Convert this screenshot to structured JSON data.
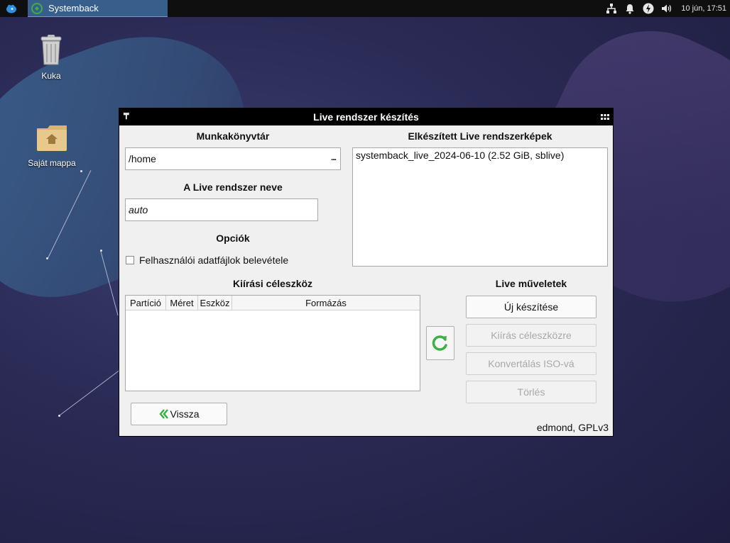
{
  "taskbar": {
    "task_label": "Systemback",
    "clock": "10 jún, 17:51"
  },
  "desktop": {
    "icons": [
      {
        "label": "Kuka",
        "icon": "trash-icon"
      },
      {
        "label": "Saját mappa",
        "icon": "home-folder-icon"
      }
    ]
  },
  "window": {
    "title": "Live rendszer készítés",
    "workdir": {
      "title": "Munkakönyvtár",
      "value": "/home",
      "browse_label": "..."
    },
    "live_name": {
      "title": "A Live rendszer neve",
      "value": "auto"
    },
    "options": {
      "title": "Opciók",
      "checkbox_label": "Felhasználói adatfájlok belevétele",
      "checked": false
    },
    "images": {
      "title": "Elkészített Live rendszerképek",
      "items": [
        "systemback_live_2024-06-10 (2.52 GiB, sblive)"
      ]
    },
    "target": {
      "title": "Kiírási céleszköz",
      "columns": [
        "Partíció",
        "Méret",
        "Eszköz",
        "Formázás"
      ]
    },
    "operations": {
      "title": "Live műveletek",
      "new_label": "Új készítése",
      "write_label": "Kiírás céleszközre",
      "convert_label": "Konvertálás ISO-vá",
      "delete_label": "Törlés"
    },
    "back_label": "Vissza",
    "footer": "edmond, GPLv3"
  },
  "colors": {
    "accent_green": "#3cb043",
    "task_blue": "#385e8c"
  }
}
